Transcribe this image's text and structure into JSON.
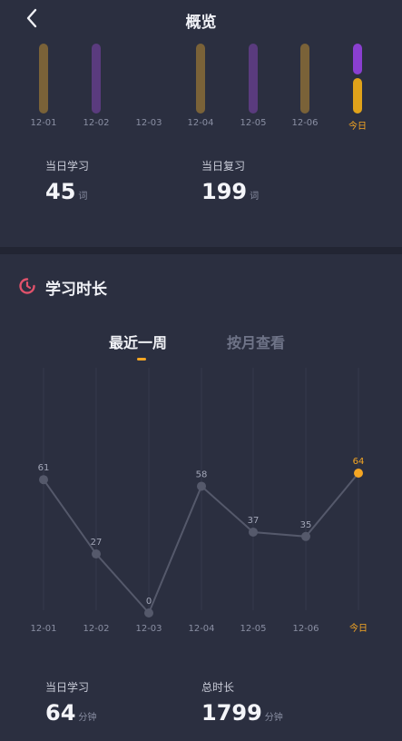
{
  "header": {
    "title": "概览",
    "back_icon": "chevron-left-icon"
  },
  "colors": {
    "accent": "#f5a623",
    "bar_brown": "#7a6238",
    "bar_purple": "#5a3b7e",
    "today_purple": "#8a3fd0",
    "today_gold": "#e0a21a"
  },
  "daily_bars": {
    "labels": [
      "12-01",
      "12-02",
      "12-03",
      "12-04",
      "12-05",
      "12-06",
      "今日"
    ]
  },
  "stats_top": {
    "study": {
      "label": "当日学习",
      "value": "45",
      "unit": "词"
    },
    "review": {
      "label": "当日复习",
      "value": "199",
      "unit": "词"
    }
  },
  "section": {
    "title": "学习时长",
    "icon": "clock-icon"
  },
  "tabs": {
    "recent": "最近一周",
    "monthly": "按月查看"
  },
  "chart_data": {
    "type": "line",
    "categories": [
      "12-01",
      "12-02",
      "12-03",
      "12-04",
      "12-05",
      "12-06",
      "今日"
    ],
    "values": [
      61,
      27,
      0,
      58,
      37,
      35,
      64
    ],
    "title": "",
    "xlabel": "",
    "ylabel": "",
    "grid": true
  },
  "stats_bottom": {
    "study": {
      "label": "当日学习",
      "value": "64",
      "unit": "分钟"
    },
    "total": {
      "label": "总时长",
      "value": "1799",
      "unit": "分钟"
    }
  }
}
